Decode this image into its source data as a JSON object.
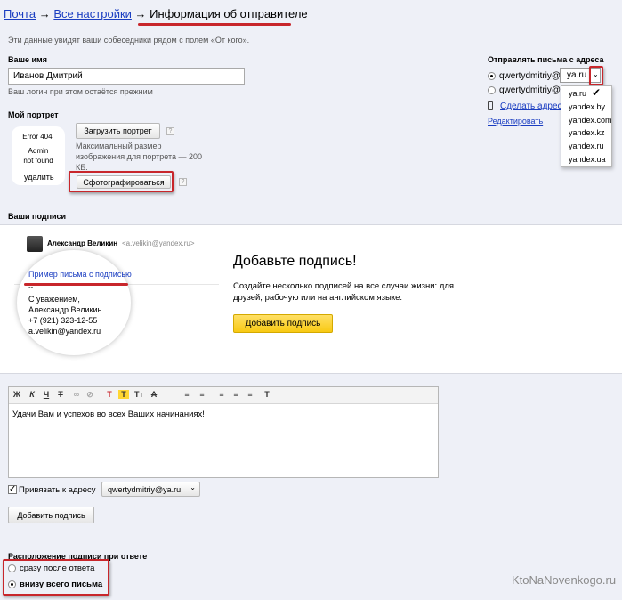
{
  "breadcrumb": {
    "home": "Почта",
    "arrow1": "→",
    "settings": "Все настройки",
    "arrow2": "→",
    "current": "Информация об отправителе"
  },
  "intro": "Эти данные увидят ваши собеседники рядом с полем «От кого».",
  "name_section": {
    "label": "Ваше имя",
    "value": "Иванов Дмитрий",
    "hint": "Ваш логин при этом остаётся прежним"
  },
  "portrait": {
    "label": "Мой портрет",
    "error_lines": [
      "Error 404:",
      "Admin",
      "not found"
    ],
    "delete": "удалить",
    "upload_button": "Загрузить портрет",
    "hint": "Максимальный размер изображения для портрета — 200 КБ.",
    "photo_button": "Сфотографироваться",
    "help": "?"
  },
  "send_from": {
    "label": "Отправлять письма с адреса",
    "login": "qwertydmitriy@",
    "domain": "ya.ru",
    "make_address_link": "Сделать адрес",
    "edit_link": "Редактировать",
    "dropdown_options": [
      "ya.ru",
      "yandex.by",
      "yandex.com",
      "yandex.kz",
      "yandex.ru",
      "yandex.ua"
    ],
    "selected_index": 0,
    "check": "✔"
  },
  "signatures": {
    "label": "Ваши подписи",
    "preview": {
      "sender_name": "Александр Великин",
      "sender_email": "<a.velikin@yandex.ru>",
      "subject": "Пример письма с подписью",
      "dash": "--",
      "lines": [
        "С уважением,",
        "Александр Великин",
        "+7 (921) 323-12-55",
        "a.velikin@yandex.ru"
      ]
    },
    "promo_title": "Добавьте подпись!",
    "promo_text": "Создайте несколько подписей на все случаи жизни: для друзей, рабочую или на английском языке.",
    "promo_button": "Добавить подпись"
  },
  "editor": {
    "toolbar": [
      "Ж",
      "К",
      "Ч",
      "Т",
      "∞",
      "⊘",
      "Т",
      "Т",
      "Тт",
      "А",
      "≡",
      "≡",
      "≡",
      "≡",
      "≡",
      "Т"
    ],
    "text": "Удачи Вам и успехов во всех Ваших начинаниях!"
  },
  "bind": {
    "label": "Привязать к адресу",
    "value": "qwertydmitriy@ya.ru",
    "checked": true
  },
  "add_signature_button": "Добавить подпись",
  "placement": {
    "label": "Расположение подписи при ответе",
    "options": [
      "сразу после ответа",
      "внизу всего письма"
    ],
    "selected_index": 1
  },
  "watermark": "KtoNaNovenkogo.ru",
  "colors": {
    "background": "#eef0f7",
    "link": "#1a3dc1",
    "highlight": "#c8262b",
    "promo_button": "#ffd633"
  },
  "icons": {
    "arrow": "chevron-down-icon",
    "phone": "phone-icon",
    "check": "check-icon"
  }
}
